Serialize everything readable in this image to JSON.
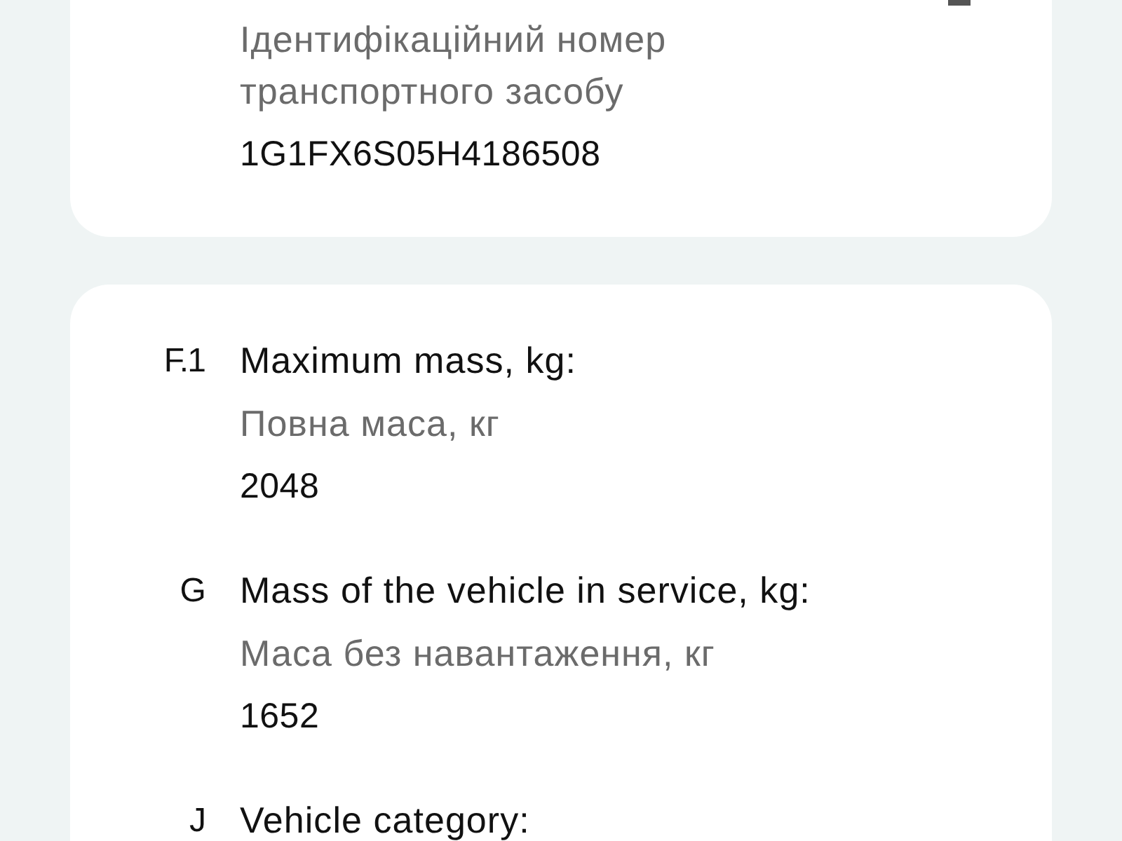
{
  "cards": [
    {
      "fields": [
        {
          "subtitle": "Ідентифікаційний номер транспортного засобу",
          "value": "1G1FX6S05H4186508"
        }
      ]
    },
    {
      "fields": [
        {
          "code": "F.1",
          "title": "Maximum mass, kg:",
          "subtitle": "Повна маса, кг",
          "value": "2048"
        },
        {
          "code": "G",
          "title": "Mass of the vehicle in service, kg:",
          "subtitle": "Маса без навантаження, кг",
          "value": "1652"
        },
        {
          "code": "J",
          "title": "Vehicle category:"
        }
      ]
    }
  ]
}
